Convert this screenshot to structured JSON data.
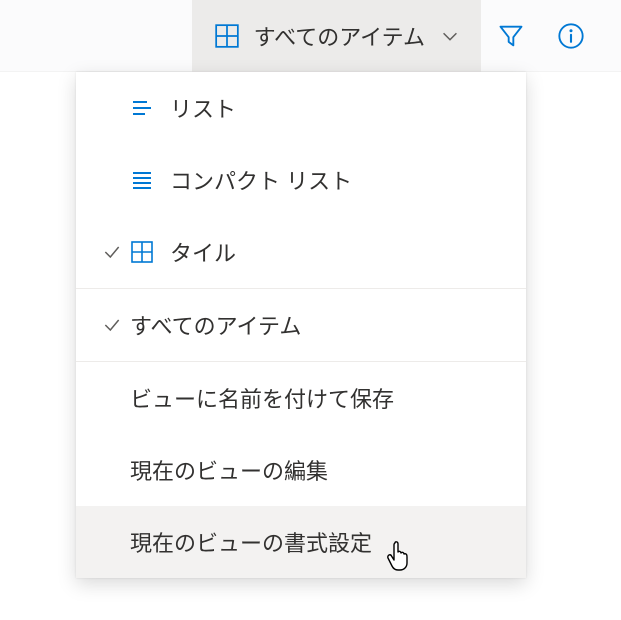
{
  "colors": {
    "accent": "#0078d4",
    "text": "#323130",
    "icon_gray": "#605e5c"
  },
  "toolbar": {
    "view_label": "すべてのアイテム"
  },
  "menu": {
    "list": "リスト",
    "compact": "コンパクト リスト",
    "tile": "タイル",
    "all_items": "すべてのアイテム",
    "save_as": "ビューに名前を付けて保存",
    "edit_current": "現在のビューの編集",
    "format_current": "現在のビューの書式設定"
  }
}
